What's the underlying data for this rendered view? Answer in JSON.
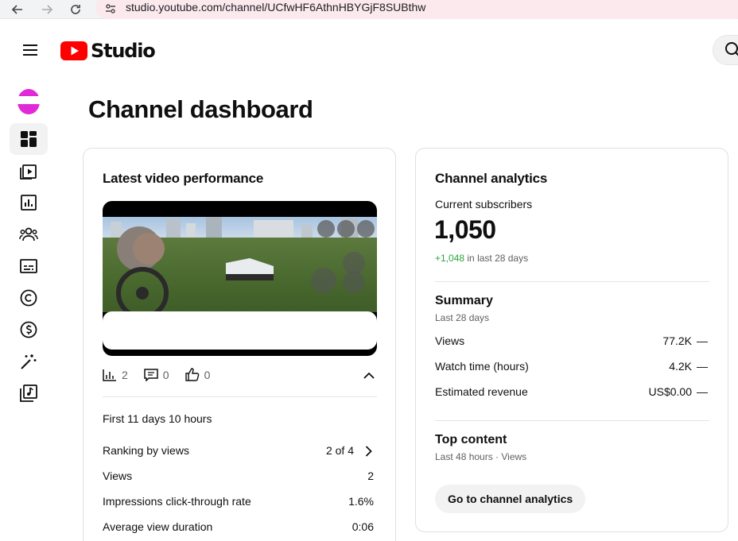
{
  "browser": {
    "url": "studio.youtube.com/channel/UCfwHF6AthnHBYGjF8SUBthw"
  },
  "header": {
    "logo_text": "Studio"
  },
  "colors": {
    "youtube_red": "#ff0000",
    "positive_green": "#2ba640",
    "avatar_magenta": "#e02ad8"
  },
  "sidebar": {
    "items": [
      {
        "icon": "dashboard-icon",
        "active": true
      },
      {
        "icon": "content-icon",
        "active": false
      },
      {
        "icon": "analytics-icon",
        "active": false
      },
      {
        "icon": "community-icon",
        "active": false
      },
      {
        "icon": "subtitles-icon",
        "active": false
      },
      {
        "icon": "copyright-icon",
        "active": false
      },
      {
        "icon": "earn-icon",
        "active": false
      },
      {
        "icon": "customization-icon",
        "active": false
      },
      {
        "icon": "audio-library-icon",
        "active": false
      }
    ]
  },
  "page": {
    "title": "Channel dashboard"
  },
  "latest_video": {
    "title": "Latest video performance",
    "views": "2",
    "comments": "0",
    "likes": "0",
    "period": "First 11 days 10 hours",
    "rows": [
      {
        "label": "Ranking by views",
        "value": "2 of 4"
      },
      {
        "label": "Views",
        "value": "2"
      },
      {
        "label": "Impressions click-through rate",
        "value": "1.6%"
      },
      {
        "label": "Average view duration",
        "value": "0:06"
      }
    ]
  },
  "channel_analytics": {
    "title": "Channel analytics",
    "subscribers_label": "Current subscribers",
    "subscribers_value": "1,050",
    "subscribers_change": "+1,048",
    "subscribers_change_suffix": "in last 28 days",
    "summary": {
      "title": "Summary",
      "subtitle": "Last 28 days",
      "rows": [
        {
          "label": "Views",
          "value": "77.2K",
          "trend": "—"
        },
        {
          "label": "Watch time (hours)",
          "value": "4.2K",
          "trend": "—"
        },
        {
          "label": "Estimated revenue",
          "value": "US$0.00",
          "trend": "—"
        }
      ]
    },
    "top_content": {
      "title": "Top content",
      "subtitle": "Last 48 hours · Views"
    },
    "button_label": "Go to channel analytics"
  }
}
